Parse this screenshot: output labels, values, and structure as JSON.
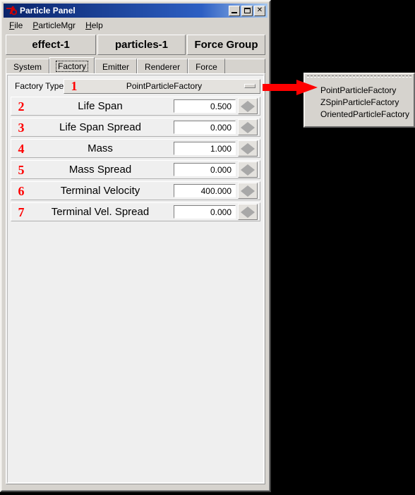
{
  "window": {
    "title": "Particle Panel",
    "icon": "perl-camel-icon",
    "controls": [
      {
        "name": "minimize-button",
        "glyph": "_"
      },
      {
        "name": "maximize-button",
        "glyph": "□"
      },
      {
        "name": "close-button",
        "glyph": "×"
      }
    ]
  },
  "menubar": {
    "items": [
      {
        "label": "File",
        "mnemonic": "F"
      },
      {
        "label": "ParticleMgr",
        "mnemonic": "P"
      },
      {
        "label": "Help",
        "mnemonic": "H"
      }
    ]
  },
  "header_buttons": [
    {
      "label": "effect-1"
    },
    {
      "label": "particles-1"
    },
    {
      "label": "Force Group"
    }
  ],
  "tabs": [
    {
      "label": "System",
      "selected": false
    },
    {
      "label": "Factory",
      "selected": true
    },
    {
      "label": "Emitter",
      "selected": false
    },
    {
      "label": "Renderer",
      "selected": false
    },
    {
      "label": "Force",
      "selected": false
    }
  ],
  "factory_type": {
    "marker": "1",
    "label": "Factory Type",
    "value": "PointParticleFactory"
  },
  "rows": [
    {
      "marker": "2",
      "label": "Life Span",
      "value": "0.500"
    },
    {
      "marker": "3",
      "label": "Life Span Spread",
      "value": "0.000"
    },
    {
      "marker": "4",
      "label": "Mass",
      "value": "1.000"
    },
    {
      "marker": "5",
      "label": "Mass Spread",
      "value": "0.000"
    },
    {
      "marker": "6",
      "label": "Terminal Velocity",
      "value": "400.000"
    },
    {
      "marker": "7",
      "label": "Terminal Vel. Spread",
      "value": "0.000"
    }
  ],
  "dropdown": {
    "tearoff": true,
    "items": [
      {
        "label": "PointParticleFactory"
      },
      {
        "label": "ZSpinParticleFactory"
      },
      {
        "label": "OrientedParticleFactory"
      }
    ]
  },
  "annotation": {
    "arrow_color": "#ff0000",
    "marker_color": "#ff0000"
  },
  "colors": {
    "titlebar_start": "#0a246a",
    "titlebar_end": "#a6c8f0",
    "face": "#d6d3ce",
    "panel": "#efefef",
    "entry_bg": "#ffffff",
    "background": "#000000"
  }
}
